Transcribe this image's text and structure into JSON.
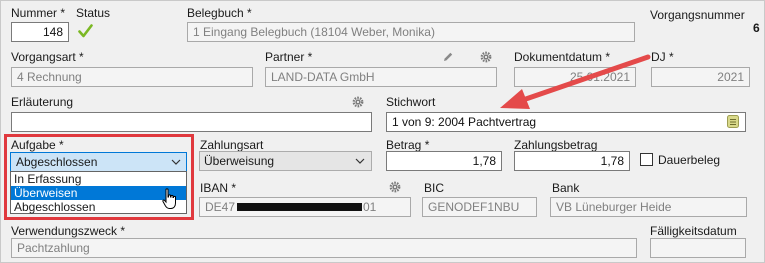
{
  "colors": {
    "accent": "#0078d7",
    "highlight_box": "#e0393e",
    "arrow": "#e44a4a",
    "check": "#7bb824",
    "textarea_icon": "#c8c86a"
  },
  "header": {
    "nummer_label": "Nummer *",
    "nummer_value": "148",
    "status_label": "Status",
    "status_icon": "checkmark-icon",
    "belegbuch_label": "Belegbuch *",
    "belegbuch_value": "1 Eingang Belegbuch   (18104 Weber, Monika)",
    "vorgangsnummer_label": "Vorgangsnummer",
    "vorgangsnummer_value": "6"
  },
  "row2": {
    "vorgangsart_label": "Vorgangsart *",
    "vorgangsart_value": "4  Rechnung",
    "partner_label": "Partner *",
    "partner_value": "LAND-DATA GmbH",
    "dokumentdatum_label": "Dokumentdatum *",
    "dokumentdatum_value": "25.01.2021",
    "dj_label": "DJ *",
    "dj_value": "2021"
  },
  "row3": {
    "erlaeuterung_label": "Erläuterung",
    "erlaeuterung_value": "",
    "stichwort_label": "Stichwort",
    "stichwort_value": "1 von 9: 2004  Pachtvertrag"
  },
  "row4": {
    "aufgabe_label": "Aufgabe *",
    "aufgabe_value": "Abgeschlossen",
    "aufgabe_options": [
      "In Erfassung",
      "Überweisen",
      "Abgeschlossen"
    ],
    "aufgabe_highlighted_option": "Überweisen",
    "zahlungsart_label": "Zahlungsart",
    "zahlungsart_value": "Überweisung",
    "betrag_label": "Betrag *",
    "betrag_value": "1,78",
    "zahlungsbetrag_label": "Zahlungsbetrag",
    "zahlungsbetrag_value": "1,78",
    "dauerbeleg_label": "Dauerbeleg"
  },
  "row5": {
    "iban_label": "IBAN *",
    "iban_value_start": "DE47",
    "iban_value_end": "01",
    "bic_label": "BIC",
    "bic_value": "GENODEF1NBU",
    "bank_label": "Bank",
    "bank_value": "VB Lüneburger Heide"
  },
  "row6": {
    "verwendungszweck_label": "Verwendungszweck *",
    "verwendungszweck_value": "Pachtzahlung",
    "faelligkeitsdatum_label": "Fälligkeitsdatum",
    "faelligkeitsdatum_value": ""
  }
}
